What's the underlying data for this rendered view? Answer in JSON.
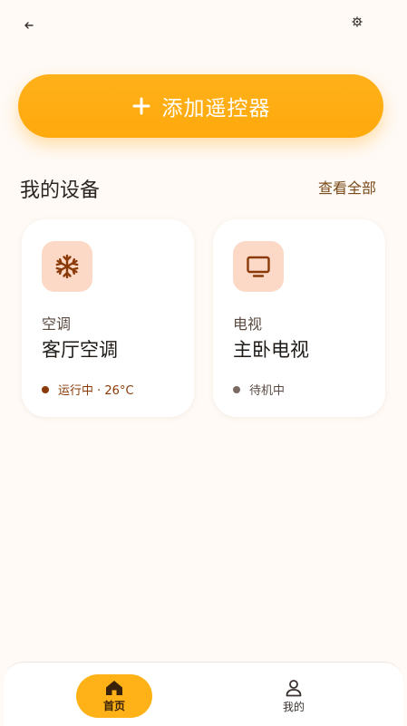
{
  "header": {
    "back_icon": "arrow-left-icon",
    "settings_icon": "gear-icon"
  },
  "add_button": {
    "label": "添加遥控器",
    "icon": "plus-icon"
  },
  "devices_section": {
    "title": "我的设备",
    "view_all": "查看全部"
  },
  "devices": [
    {
      "type": "空调",
      "name": "客厅空调",
      "status": "运行中 · 26°C",
      "icon": "snowflake-icon",
      "status_color": "#8a3a08"
    },
    {
      "type": "电视",
      "name": "主卧电视",
      "status": "待机中",
      "icon": "tv-icon",
      "status_color": "#7a6a62"
    }
  ],
  "bottom_nav": {
    "home_label": "首页",
    "mine_label": "我的",
    "home_icon": "home-icon",
    "mine_icon": "user-icon"
  },
  "colors": {
    "accent": "#ffab10",
    "icon_bg": "#fcd9c6",
    "icon_fg": "#8a3a08",
    "text_brown": "#7a4a18"
  }
}
